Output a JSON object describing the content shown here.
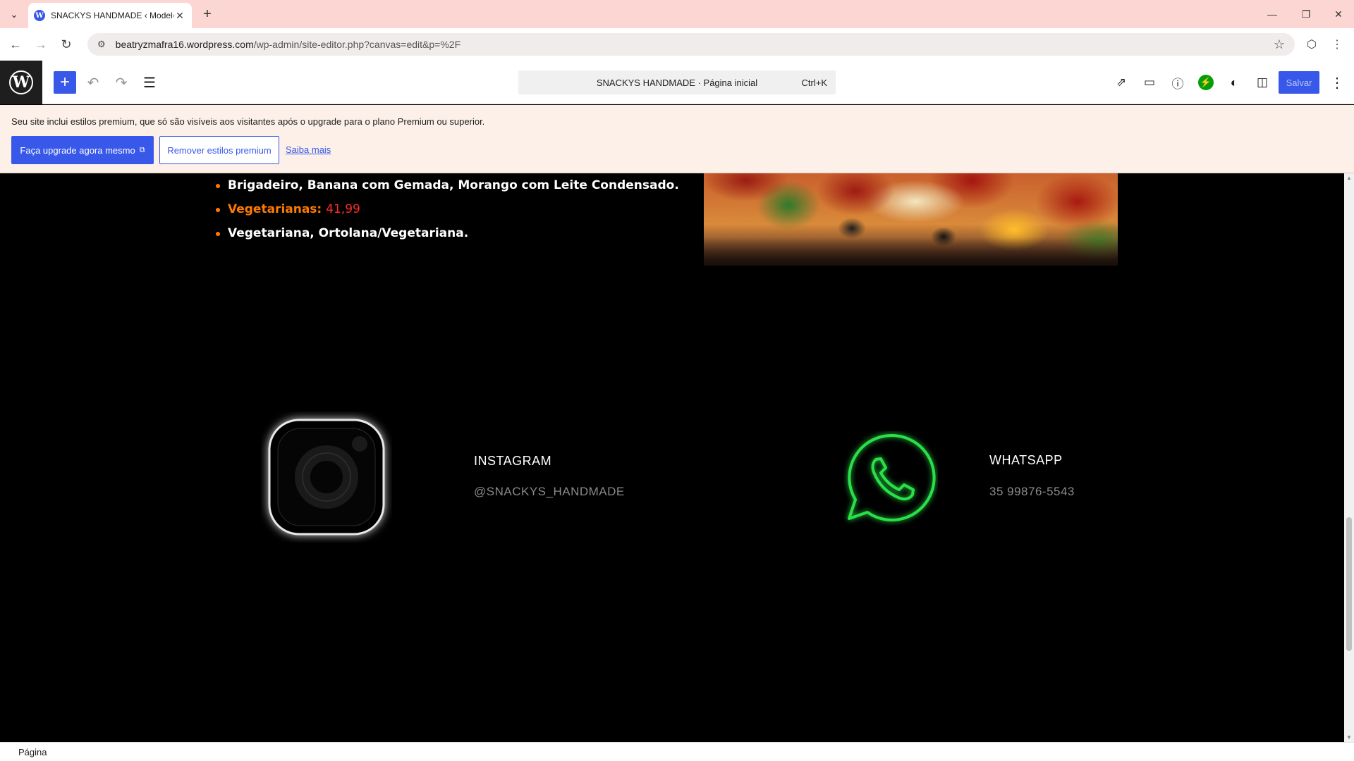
{
  "browser": {
    "tab_title": "SNACKYS HANDMADE ‹ Modelo",
    "url_host": "beatryzmafra16.wordpress.com",
    "url_path": "/wp-admin/site-editor.php?canvas=edit&p=%2F"
  },
  "editor": {
    "document_title": "SNACKYS HANDMADE · Página inicial",
    "shortcut": "Ctrl+K",
    "save_label": "Salvar",
    "accent_color": "#3858e9"
  },
  "notice": {
    "message": "Seu site inclui estilos premium, que só são visíveis aos visitantes após o upgrade para o plano Premium ou superior.",
    "upgrade_label": "Faça upgrade agora mesmo",
    "remove_label": "Remover estilos premium",
    "learn_more_label": "Saiba mais"
  },
  "page": {
    "menu_items": [
      {
        "text": "Brigadeiro, Banana com Gemada, Morango com Leite Condensado."
      },
      {
        "category": "Vegetarianas:",
        "price": "41,99"
      },
      {
        "text": "Vegetariana, Ortolana/Vegetariana."
      }
    ],
    "instagram": {
      "title": "INSTAGRAM",
      "handle": "@SNACKYS_HANDMADE"
    },
    "whatsapp": {
      "title": "WHATSAPP",
      "number": "35 99876-5543"
    }
  },
  "footer": {
    "breadcrumb": "Página"
  }
}
